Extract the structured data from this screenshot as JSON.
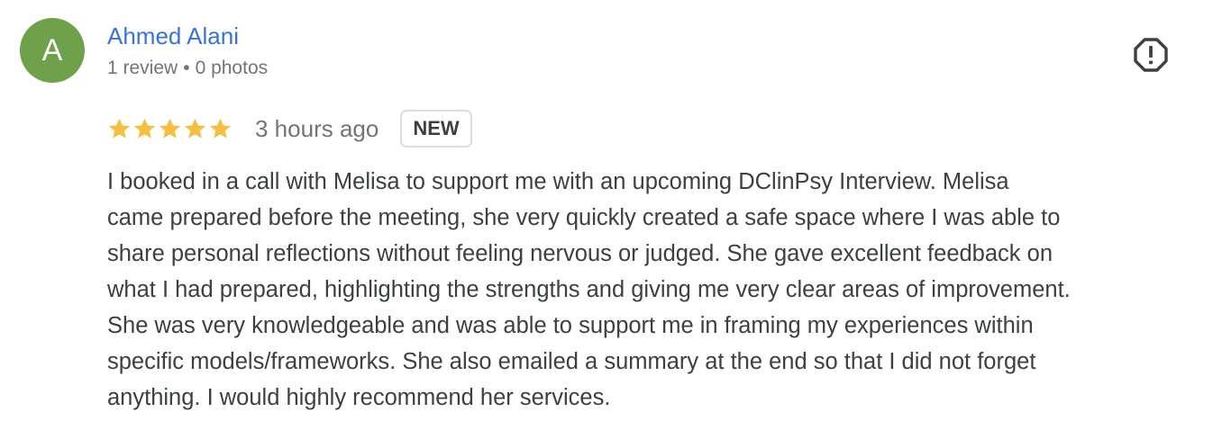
{
  "reviewer": {
    "initial": "A",
    "avatar_color": "#6fa04a",
    "name": "Ahmed Alani",
    "name_color": "#3a73d8",
    "review_count": "1 review",
    "separator": "•",
    "photo_count": "0 photos"
  },
  "actions": {
    "flag_icon": "report-flag-icon"
  },
  "review": {
    "rating": 5,
    "star_color": "#f4bf42",
    "time_ago": "3 hours ago",
    "badge": "NEW",
    "text_lines": [
      "I booked in a call with Melisa to support me with an upcoming DClinPsy Interview. Melisa",
      "came prepared before the meeting, she very quickly created a safe space where I was able to",
      "share personal reflections without feeling nervous or judged. She gave excellent feedback on",
      "what I had prepared, highlighting the strengths and giving me very clear areas of improvement.",
      "She was very knowledgeable and was able to support me in framing my experiences within",
      "specific models/frameworks. She also emailed a summary at the end so that I did not forget",
      "anything. I would highly recommend her services."
    ]
  }
}
